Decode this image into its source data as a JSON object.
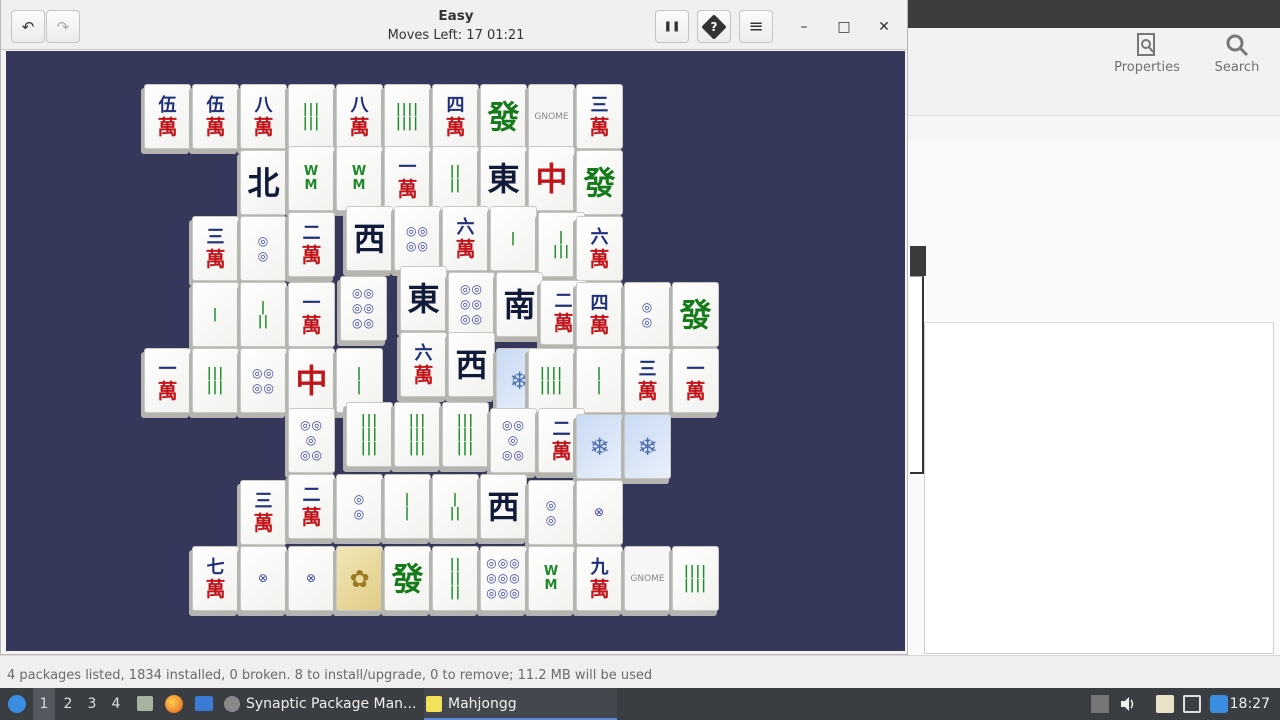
{
  "mahjongg": {
    "title": "Easy",
    "subtitle": "Moves Left: 17   01:21",
    "buttons": {
      "undo": "↶",
      "redo": "↷",
      "pause": "❚❚",
      "hint": "?",
      "menu": "≡"
    },
    "window_controls": {
      "minimize": "–",
      "maximize": "□",
      "close": "✕"
    },
    "board_color": "#35385a"
  },
  "synaptic": {
    "toolbar": {
      "properties": "Properties",
      "search": "Search"
    },
    "status": "4 packages listed, 1834 installed, 0 broken. 8 to install/upgrade, 0 to remove; 11.2 MB will be used"
  },
  "taskbar": {
    "workspaces": [
      "1",
      "2",
      "3",
      "4"
    ],
    "apps": [
      {
        "label": "Synaptic Package Man...",
        "icon": "synaptic-icon"
      },
      {
        "label": "Mahjongg",
        "icon": "mahjongg-icon"
      }
    ],
    "clock": "18:27"
  },
  "tiles": [
    {
      "kind": "char",
      "top": "伍",
      "bottom": "萬"
    },
    {
      "kind": "char",
      "top": "伍",
      "bottom": "萬"
    },
    {
      "kind": "char",
      "top": "八",
      "bottom": "萬"
    },
    {
      "kind": "bam",
      "text": "|||\n|||"
    },
    {
      "kind": "char",
      "top": "八",
      "bottom": "萬"
    },
    {
      "kind": "bam",
      "text": "||||\n||||"
    },
    {
      "kind": "char",
      "top": "四",
      "bottom": "萬"
    },
    {
      "kind": "dragon",
      "text": "發",
      "color": "green"
    },
    {
      "kind": "gnome",
      "text": "GNOME"
    },
    {
      "kind": "char",
      "top": "三",
      "bottom": "萬"
    },
    {
      "kind": "wind",
      "text": "北"
    },
    {
      "kind": "bam",
      "text": "W\nM"
    },
    {
      "kind": "bam",
      "text": "W\nM"
    },
    {
      "kind": "char",
      "top": "一",
      "bottom": "萬"
    },
    {
      "kind": "bam",
      "text": "||\n||"
    },
    {
      "kind": "wind",
      "text": "東"
    },
    {
      "kind": "dragon",
      "text": "中",
      "color": "red"
    },
    {
      "kind": "dragon",
      "text": "發",
      "color": "green"
    },
    {
      "kind": "char",
      "top": "三",
      "bottom": "萬"
    },
    {
      "kind": "dots",
      "text": "◎\n◎"
    },
    {
      "kind": "char",
      "top": "二",
      "bottom": "萬"
    },
    {
      "kind": "wind",
      "text": "西"
    },
    {
      "kind": "dots",
      "text": "◎◎\n◎◎"
    },
    {
      "kind": "char",
      "top": "六",
      "bottom": "萬"
    },
    {
      "kind": "bam",
      "text": "|"
    },
    {
      "kind": "bam",
      "text": "|\n|||"
    },
    {
      "kind": "char",
      "top": "六",
      "bottom": "萬"
    },
    {
      "kind": "bam",
      "text": "|"
    },
    {
      "kind": "bam",
      "text": "|\n||"
    },
    {
      "kind": "char",
      "top": "一",
      "bottom": "萬"
    },
    {
      "kind": "dots",
      "text": "◎◎\n◎◎\n◎◎"
    },
    {
      "kind": "wind",
      "text": "東"
    },
    {
      "kind": "dots",
      "text": "◎◎\n◎◎\n◎◎"
    },
    {
      "kind": "wind",
      "text": "南"
    },
    {
      "kind": "char",
      "top": "二",
      "bottom": "萬"
    },
    {
      "kind": "char",
      "top": "四",
      "bottom": "萬"
    },
    {
      "kind": "dots",
      "text": "◎\n◎"
    },
    {
      "kind": "dragon",
      "text": "發",
      "color": "green"
    },
    {
      "kind": "char",
      "top": "一",
      "bottom": "萬"
    },
    {
      "kind": "bam",
      "text": "|||\n|||"
    },
    {
      "kind": "dots",
      "text": "◎◎\n◎◎"
    },
    {
      "kind": "dragon",
      "text": "中",
      "color": "red"
    },
    {
      "kind": "bam",
      "text": "|\n|"
    },
    {
      "kind": "char",
      "top": "六",
      "bottom": "萬"
    },
    {
      "kind": "wind",
      "text": "西"
    },
    {
      "kind": "season",
      "text": "❄"
    },
    {
      "kind": "bam",
      "text": "||||\n||||"
    },
    {
      "kind": "bam",
      "text": "|\n|"
    },
    {
      "kind": "char",
      "top": "三",
      "bottom": "萬"
    },
    {
      "kind": "char",
      "top": "一",
      "bottom": "萬"
    },
    {
      "kind": "dots",
      "text": "◎◎\n◎\n◎◎"
    },
    {
      "kind": "bam",
      "text": "|||\n|||\n|||"
    },
    {
      "kind": "bam",
      "text": "|||\n|||\n|||"
    },
    {
      "kind": "bam",
      "text": "|||\n|||\n|||"
    },
    {
      "kind": "dots",
      "text": "◎◎\n◎\n◎◎"
    },
    {
      "kind": "char",
      "top": "二",
      "bottom": "萬"
    },
    {
      "kind": "season",
      "text": "❄"
    },
    {
      "kind": "season",
      "text": "❄"
    },
    {
      "kind": "char",
      "top": "三",
      "bottom": "萬"
    },
    {
      "kind": "char",
      "top": "二",
      "bottom": "萬"
    },
    {
      "kind": "dots",
      "text": "◎\n◎"
    },
    {
      "kind": "bam",
      "text": "|\n|"
    },
    {
      "kind": "bam",
      "text": "|\n||"
    },
    {
      "kind": "wind",
      "text": "西"
    },
    {
      "kind": "dots",
      "text": "◎\n◎"
    },
    {
      "kind": "dots",
      "text": "⊗"
    },
    {
      "kind": "char",
      "top": "七",
      "bottom": "萬"
    },
    {
      "kind": "dots",
      "text": "⊗"
    },
    {
      "kind": "dots",
      "text": "⊗"
    },
    {
      "kind": "flower",
      "text": "✿"
    },
    {
      "kind": "dragon",
      "text": "發",
      "color": "green"
    },
    {
      "kind": "bam",
      "text": "||\n||\n||"
    },
    {
      "kind": "dots",
      "text": "◎◎◎\n◎◎◎\n◎◎◎"
    },
    {
      "kind": "bam",
      "text": "W\nM"
    },
    {
      "kind": "char",
      "top": "九",
      "bottom": "萬"
    },
    {
      "kind": "gnome",
      "text": "GNOME"
    },
    {
      "kind": "bam",
      "text": "||||\n||||"
    }
  ]
}
